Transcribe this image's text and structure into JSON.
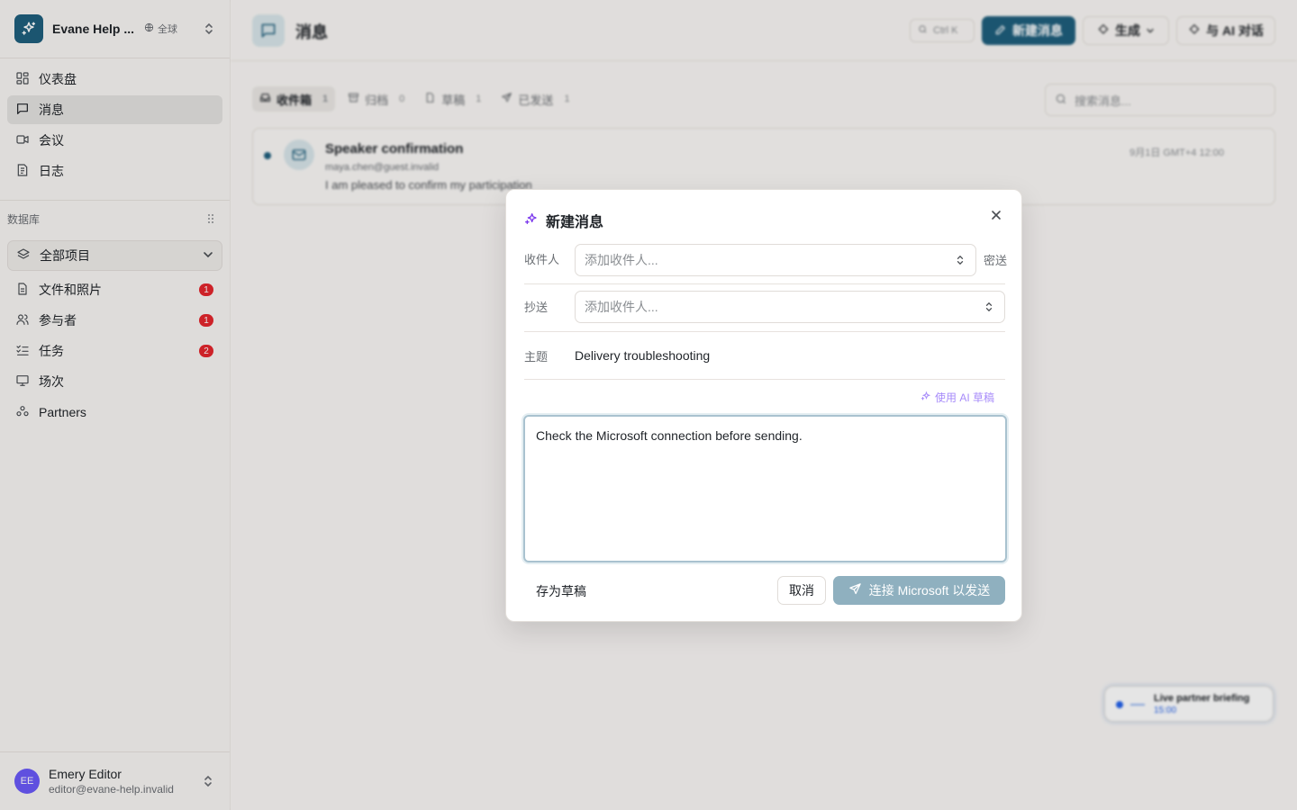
{
  "colors": {
    "brand": "#1f5f7d",
    "badge": "#e5262d",
    "avatar": "#6a5af9",
    "ai": "#a78bfa",
    "send_disabled": "#8fb0bf"
  },
  "workspace": {
    "name": "Evane Help ...",
    "scope": "全球",
    "logo_icon": "sparkles-icon"
  },
  "sidebar": {
    "nav": [
      {
        "label": "仪表盘",
        "icon": "dashboard-icon"
      },
      {
        "label": "消息",
        "icon": "message-icon",
        "active": true
      },
      {
        "label": "会议",
        "icon": "video-icon"
      },
      {
        "label": "日志",
        "icon": "log-icon"
      }
    ],
    "section_label": "数据库",
    "db_selector": "全部项目",
    "db_items": [
      {
        "label": "文件和照片",
        "icon": "file-icon",
        "badge": "1"
      },
      {
        "label": "参与者",
        "icon": "users-icon",
        "badge": "1"
      },
      {
        "label": "任务",
        "icon": "tasks-icon",
        "badge": "2"
      },
      {
        "label": "场次",
        "icon": "presentation-icon"
      },
      {
        "label": "Partners",
        "icon": "partners-icon"
      }
    ],
    "user": {
      "initials": "EE",
      "name": "Emery Editor",
      "email": "editor@evane-help.invalid"
    }
  },
  "header": {
    "title": "消息",
    "search_shortcut": "Ctrl K",
    "new_message": "新建消息",
    "generate": "生成",
    "ai_chat": "与 AI 对话"
  },
  "tabs": [
    {
      "label": "收件箱",
      "count": "1"
    },
    {
      "label": "归档",
      "count": "0"
    },
    {
      "label": "草稿",
      "count": "1"
    },
    {
      "label": "已发送",
      "count": "1"
    }
  ],
  "message_search_placeholder": "搜索消息...",
  "message": {
    "subject": "Speaker confirmation",
    "from": "maya.chen@guest.invalid",
    "preview": "I am pleased to confirm my participation",
    "date": "9月1日 GMT+4 12:00"
  },
  "live": {
    "title": "Live partner briefing",
    "time": "15:00"
  },
  "dialog": {
    "title": "新建消息",
    "to_label": "收件人",
    "to_placeholder": "添加收件人...",
    "bcc": "密送",
    "cc_label": "抄送",
    "cc_placeholder": "添加收件人...",
    "subject_label": "主题",
    "subject_value": "Delivery troubleshooting",
    "ai_draft": "使用 AI 草稿",
    "body": "Check the Microsoft connection before sending.",
    "save_draft": "存为草稿",
    "cancel": "取消",
    "send": "连接 Microsoft 以发送"
  }
}
